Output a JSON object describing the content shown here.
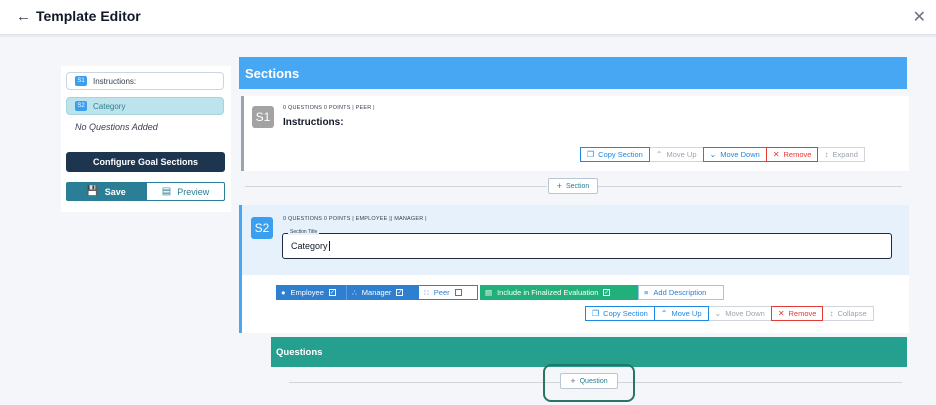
{
  "header": {
    "title": "Template Editor",
    "back_icon": "arrow-left-icon",
    "close_icon": "close-icon"
  },
  "sidebar": {
    "items": [
      {
        "badge": "S1",
        "label": "Instructions:"
      },
      {
        "badge": "S2",
        "label": "Category"
      }
    ],
    "no_questions": "No Questions Added",
    "configure_button": "Configure Goal Sections",
    "save_button": "Save",
    "preview_button": "Preview"
  },
  "sections": {
    "header": "Sections",
    "add_section": "Section",
    "s1": {
      "badge": "S1",
      "meta": "0 QUESTIONS   0 POINTS   | PEER |",
      "title": "Instructions:",
      "controls": {
        "copy": "Copy Section",
        "move_up": "Move Up",
        "move_down": "Move Down",
        "remove": "Remove",
        "expand": "Expand"
      }
    },
    "s2": {
      "badge": "S2",
      "meta": "0 QUESTIONS   0 POINTS   | EMPLOYEE || MANAGER |",
      "field_label": "Section Title",
      "field_value": "Category",
      "tags": {
        "employee": "Employee",
        "manager": "Manager",
        "peer": "Peer",
        "include": "Include in Finalized Evaluation",
        "description": "Add Description"
      },
      "controls": {
        "copy": "Copy Section",
        "move_up": "Move Up",
        "move_down": "Move Down",
        "remove": "Remove",
        "collapse": "Collapse"
      }
    }
  },
  "questions": {
    "header": "Questions",
    "add_question": "Question"
  },
  "colors": {
    "sections_blue": "#48a7f3",
    "questions_teal": "#26a08e",
    "save_teal": "#2a7e95",
    "configure_navy": "#1e3550",
    "include_green": "#22b07a"
  }
}
